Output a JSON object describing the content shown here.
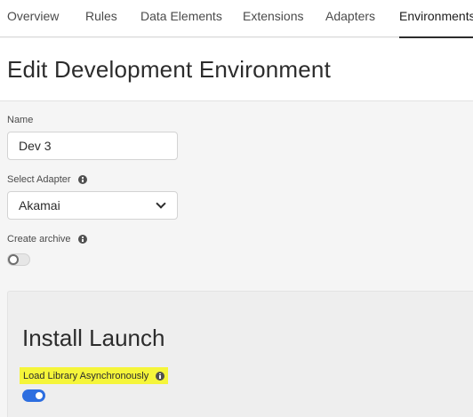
{
  "nav": {
    "tabs": [
      {
        "label": "Overview"
      },
      {
        "label": "Rules"
      },
      {
        "label": "Data Elements"
      },
      {
        "label": "Extensions"
      },
      {
        "label": "Adapters"
      },
      {
        "label": "Environments"
      }
    ],
    "active_tab": "Environments"
  },
  "page": {
    "title": "Edit Development Environment"
  },
  "form": {
    "name_label": "Name",
    "name_value": "Dev 3",
    "adapter_label": "Select Adapter",
    "adapter_value": "Akamai",
    "archive_label": "Create archive",
    "archive_enabled": false
  },
  "install": {
    "title": "Install Launch",
    "async_label": "Load Library Asynchronously",
    "async_enabled": true,
    "highlight_color": "#f5f53a",
    "toggle_color": "#2d6ee0"
  }
}
